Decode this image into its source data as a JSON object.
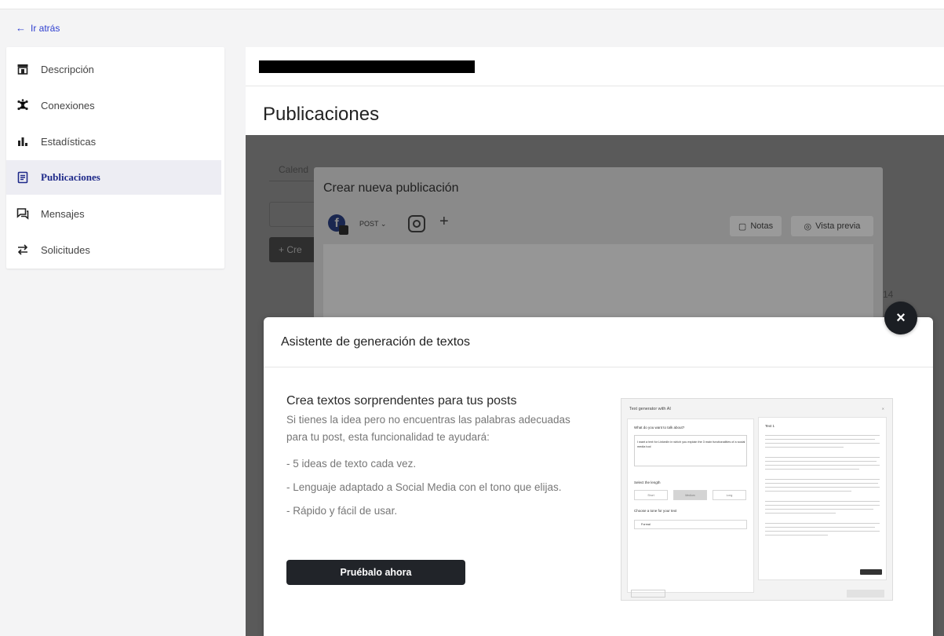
{
  "nav": {
    "back_label": "Ir atrás"
  },
  "sidebar": {
    "items": [
      {
        "label": "Descripción",
        "icon": "storefront-icon",
        "active": false
      },
      {
        "label": "Conexiones",
        "icon": "network-icon",
        "active": false
      },
      {
        "label": "Estadísticas",
        "icon": "bar-chart-icon",
        "active": false
      },
      {
        "label": "Publicaciones",
        "icon": "document-icon",
        "active": true
      },
      {
        "label": "Mensajes",
        "icon": "chat-icon",
        "active": false
      },
      {
        "label": "Solicitudes",
        "icon": "swap-icon",
        "active": false
      }
    ]
  },
  "page": {
    "title": "Publicaciones"
  },
  "create_post": {
    "title": "Crear nueva publicación",
    "post_type": "POST",
    "notes_label": "Notas",
    "preview_label": "Vista previa",
    "add_symbol": "+"
  },
  "background": {
    "tab_partial": "Calend",
    "create_partial": "+ Cre",
    "number_partial": "14"
  },
  "assistant": {
    "title": "Asistente de generación de textos",
    "heading": "Crea textos sorprendentes para tus posts",
    "description": "Si tienes la idea pero no encuentras las palabras adecuadas para tu post, esta funcionalidad te ayudará:",
    "bullets": [
      "- 5 ideas de texto cada vez.",
      "- Lenguaje adaptado a Social Media con el tono que elijas.",
      "- Rápido y fácil de usar."
    ],
    "cta_label": "Pruébalo ahora",
    "close_symbol": "×",
    "preview": {
      "title": "Text generator with AI",
      "prompt_label": "What do you want to talk about?",
      "prompt_text": "I want a text for LinkedIn in which you explain the 3 main functionalities of a social media tool",
      "length_label": "Select the length",
      "length_options": [
        "Short",
        "Medium",
        "Long"
      ],
      "tone_label": "Choose a tone for your text",
      "tone_value": "Formal",
      "result_label": "Text 1"
    }
  },
  "colors": {
    "accent": "#1f2a8a",
    "link": "#2f3fd0",
    "active_bg": "#ededf3",
    "cta_bg": "#212429"
  }
}
